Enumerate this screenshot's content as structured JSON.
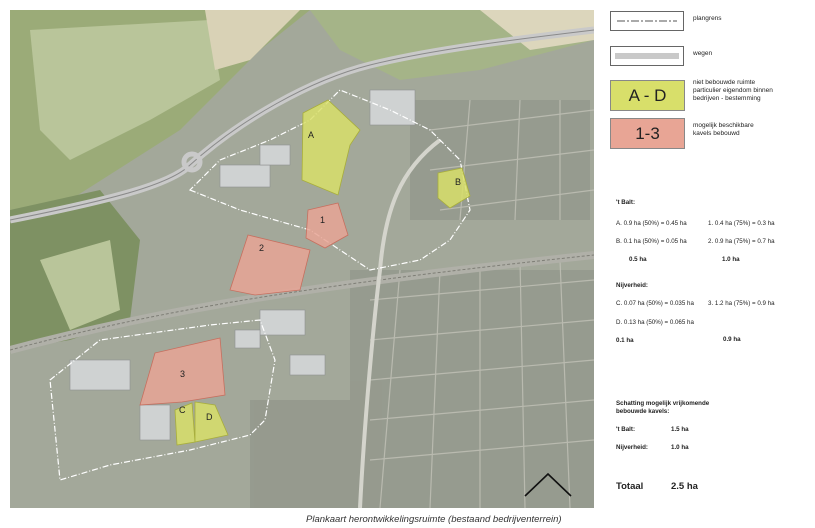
{
  "legend": {
    "plangrens": "plangrens",
    "wegen": "wegen",
    "ad_badge": "A - D",
    "ad_text": [
      "niet bebouwde ruimte",
      "particulier eigendom binnen",
      "bedrijven - bestemming"
    ],
    "k13_badge": "1-3",
    "k13_text": [
      "mogelijk beschikbare",
      "kavels bebouwd"
    ]
  },
  "colors": {
    "ad": "#d8df6a",
    "k13": "#e8a595",
    "road": "#c9c9c9"
  },
  "map_labels": [
    "A",
    "B",
    "C",
    "D",
    "1",
    "2",
    "3"
  ],
  "balt": {
    "heading": "'t Balt:",
    "rows": [
      {
        "left": "A.   0.9 ha (50%) = 0.45 ha",
        "right": "1.     0.4 ha (75%) = 0.3 ha"
      },
      {
        "left": "B.   0.1 ha (50%) = 0.05 ha",
        "right": "2.     0.9 ha (75%) = 0.7 ha"
      }
    ],
    "total_left": "0.5 ha",
    "total_right": "1.0 ha"
  },
  "nijverheid": {
    "heading": "Nijverheid:",
    "row_c": "C.   0.07 ha (50%) = 0.035 ha",
    "row_3": "3.     1.2 ha (75%) = 0.9 ha",
    "row_d": "D.   0.13 ha (50%) = 0.065 ha",
    "total_left": "0.1 ha",
    "total_right": "0.9 ha"
  },
  "schatting": {
    "heading": [
      "Schatting mogelijk vrijkomende",
      "bebouwde kavels:"
    ],
    "balt_label": "'t Balt:",
    "balt_value": "1.5 ha",
    "nijv_label": "Nijverheid:",
    "nijv_value": "1.0 ha"
  },
  "totaal": {
    "label": "Totaal",
    "value": "2.5 ha"
  },
  "caption": "Plankaart herontwikkelingsruimte (bestaand bedrijventerrein)"
}
